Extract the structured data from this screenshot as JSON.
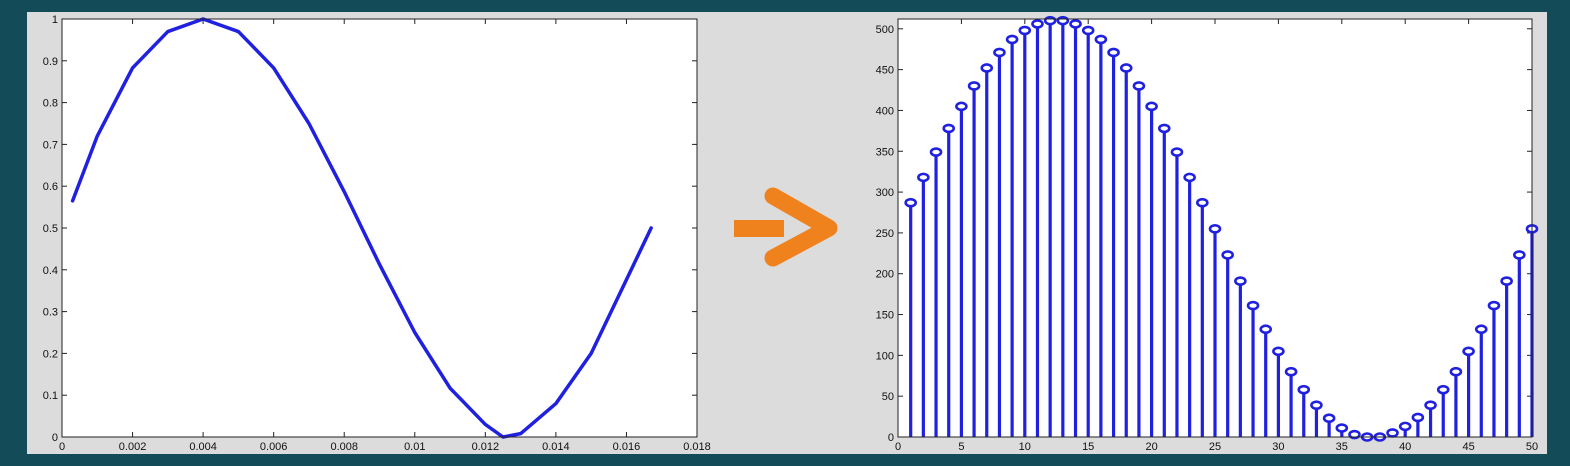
{
  "colors": {
    "background": "#134b58",
    "panel": "#dcdcdc",
    "series": "#2020e0",
    "arrow": "#f0821e"
  },
  "arrow_icon": "right-arrow-icon",
  "chart_data": [
    {
      "type": "line",
      "title": "",
      "xlabel": "",
      "ylabel": "",
      "xlim": [
        0,
        0.018
      ],
      "ylim": [
        0,
        1
      ],
      "xticks": [
        0,
        0.002,
        0.004,
        0.006,
        0.008,
        0.01,
        0.012,
        0.014,
        0.016,
        0.018
      ],
      "xtick_labels": [
        "0",
        "0.002",
        "0.004",
        "0.006",
        "0.008",
        "0.01",
        "0.012",
        "0.014",
        "0.016",
        "0.018"
      ],
      "yticks": [
        0,
        0.1,
        0.2,
        0.3,
        0.4,
        0.5,
        0.6,
        0.7,
        0.8,
        0.9,
        1
      ],
      "ytick_labels": [
        "0",
        "0.1",
        "0.2",
        "0.3",
        "0.4",
        "0.5",
        "0.6",
        "0.7",
        "0.8",
        "0.9",
        "1"
      ],
      "grid": false,
      "series": [
        {
          "x": [
            0.0003,
            0.001,
            0.002,
            0.003,
            0.004,
            0.005,
            0.006,
            0.007,
            0.008,
            0.009,
            0.01,
            0.011,
            0.012,
            0.0125,
            0.013,
            0.014,
            0.015,
            0.0167
          ],
          "y": [
            0.565,
            0.72,
            0.883,
            0.97,
            1.0,
            0.97,
            0.883,
            0.75,
            0.587,
            0.413,
            0.25,
            0.117,
            0.03,
            0.0,
            0.008,
            0.08,
            0.2,
            0.5
          ]
        }
      ]
    },
    {
      "type": "stem",
      "title": "",
      "xlabel": "",
      "ylabel": "",
      "xlim": [
        0,
        50
      ],
      "ylim": [
        0,
        512
      ],
      "xticks": [
        0,
        5,
        10,
        15,
        20,
        25,
        30,
        35,
        40,
        45,
        50
      ],
      "xtick_labels": [
        "0",
        "5",
        "10",
        "15",
        "20",
        "25",
        "30",
        "35",
        "40",
        "45",
        "50"
      ],
      "yticks": [
        0,
        50,
        100,
        150,
        200,
        250,
        300,
        350,
        400,
        450,
        500
      ],
      "ytick_labels": [
        "0",
        "50",
        "100",
        "150",
        "200",
        "250",
        "300",
        "350",
        "400",
        "450",
        "500"
      ],
      "grid": false,
      "series": [
        {
          "x": [
            1,
            2,
            3,
            4,
            5,
            6,
            7,
            8,
            9,
            10,
            11,
            12,
            13,
            14,
            15,
            16,
            17,
            18,
            19,
            20,
            21,
            22,
            23,
            24,
            25,
            26,
            27,
            28,
            29,
            30,
            31,
            32,
            33,
            34,
            35,
            36,
            37,
            38,
            39,
            40,
            41,
            42,
            43,
            44,
            45,
            46,
            47,
            48,
            49,
            50
          ],
          "y": [
            287,
            318,
            349,
            378,
            405,
            430,
            452,
            471,
            487,
            498,
            506,
            510,
            510,
            506,
            498,
            487,
            471,
            452,
            430,
            405,
            378,
            349,
            318,
            287,
            255,
            223,
            191,
            161,
            132,
            105,
            80,
            58,
            39,
            23,
            11,
            3,
            0,
            0,
            5,
            13,
            24,
            39,
            58,
            80,
            105,
            132,
            161,
            191,
            223,
            255
          ]
        }
      ]
    }
  ]
}
